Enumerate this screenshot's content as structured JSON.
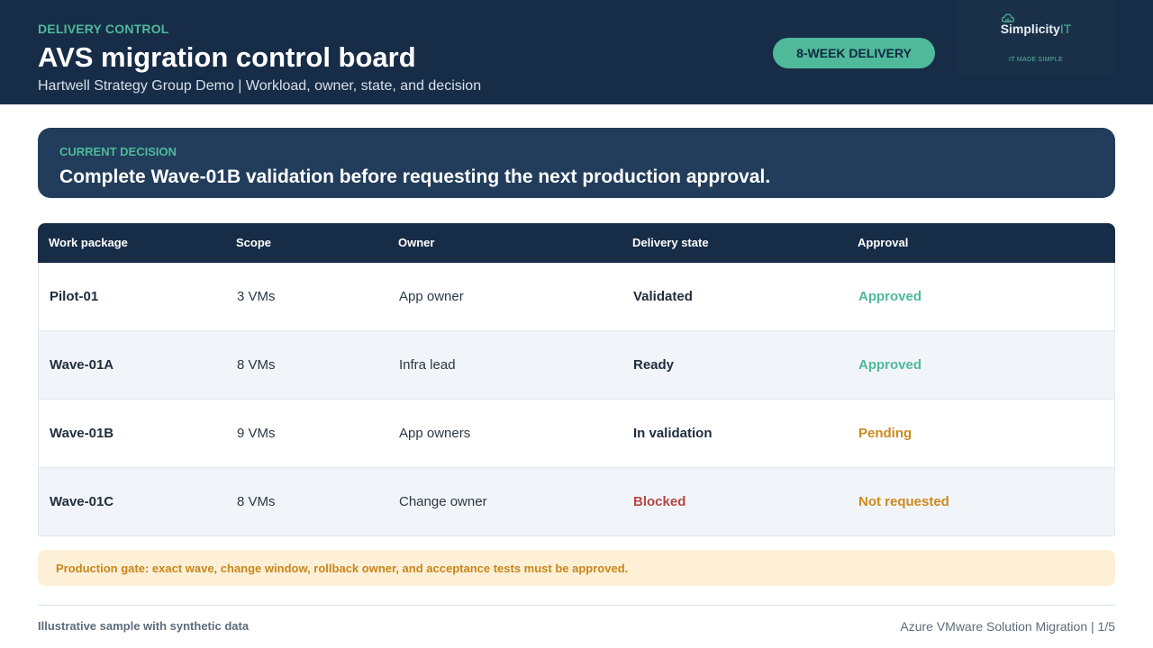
{
  "header": {
    "eyebrow": "DELIVERY CONTROL",
    "title": "AVS migration control board",
    "subtitle": "Hartwell Strategy Group Demo | Workload, owner, state, and decision",
    "badge": "8-WEEK DELIVERY",
    "logo": {
      "name": "Simplicity",
      "suffix": "IT",
      "tagline": "IT MADE SIMPLE",
      "icon": "cloud-icon"
    }
  },
  "decision": {
    "label": "CURRENT DECISION",
    "text": "Complete Wave-01B validation before requesting the next production approval."
  },
  "table": {
    "columns": [
      "Work package",
      "Scope",
      "Owner",
      "Delivery state",
      "Approval"
    ],
    "rows": [
      {
        "package": "Pilot-01",
        "scope": "3 VMs",
        "owner": "App owner",
        "state": "Validated",
        "approval": "Approved"
      },
      {
        "package": "Wave-01A",
        "scope": "8 VMs",
        "owner": "Infra lead",
        "state": "Ready",
        "approval": "Approved"
      },
      {
        "package": "Wave-01B",
        "scope": "9 VMs",
        "owner": "App owners",
        "state": "In validation",
        "approval": "Pending"
      },
      {
        "package": "Wave-01C",
        "scope": "8 VMs",
        "owner": "Change owner",
        "state": "Blocked",
        "approval": "Not requested"
      }
    ]
  },
  "gate": {
    "text": "Production gate: exact wave, change window, rollback owner, and acceptance tests must be approved."
  },
  "footer": {
    "left": "Illustrative sample with synthetic data",
    "right": "Azure VMware Solution Migration | 1/5"
  },
  "colors": {
    "navy": "#172c47",
    "accent": "#4fb99a",
    "warning": "#cc8a1e",
    "danger": "#b94545"
  }
}
